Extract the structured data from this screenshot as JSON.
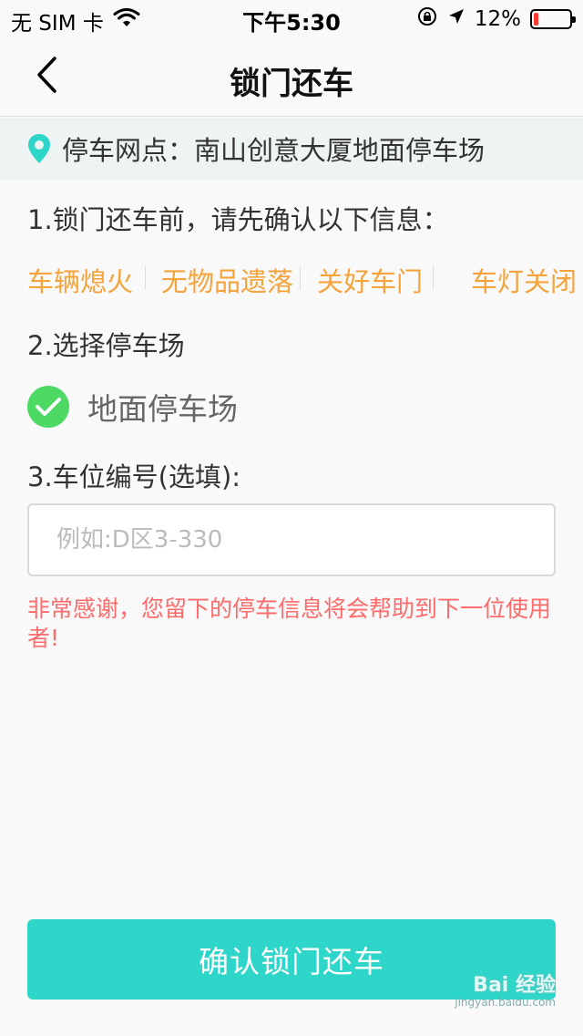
{
  "status_bar": {
    "carrier": "无 SIM 卡",
    "time": "下午5:30",
    "battery_percent": "12%",
    "battery_level": 0.12,
    "icons": [
      "wifi-icon",
      "orientation-lock-icon",
      "location-arrow-icon",
      "battery-icon"
    ],
    "battery_color": "#ff3b30"
  },
  "nav": {
    "title": "锁门还车",
    "back_icon": "chevron-left-icon"
  },
  "location": {
    "label": "停车网点：南山创意大厦地面停车场",
    "icon": "location-pin-icon",
    "icon_color": "#2ed5c9"
  },
  "section1": {
    "title": "1.锁门还车前，请先确认以下信息：",
    "items": [
      "车辆熄火",
      "无物品遗落",
      "关好车门",
      "车灯关闭"
    ],
    "item_color": "#f5a33b"
  },
  "section2": {
    "title": "2.选择停车场",
    "option_label": "地面停车场",
    "selected": true,
    "check_color": "#4cd964"
  },
  "section3": {
    "title": "3.车位编号(选填):",
    "input_value": "",
    "input_placeholder": "例如:D区3-330"
  },
  "note": {
    "text": "非常感谢，您留下的停车信息将会帮助到下一位使用者!",
    "color": "#ff6b6b"
  },
  "confirm_button": {
    "label": "确认锁门还车",
    "color": "#2ed5c9"
  },
  "watermark": {
    "main": "Bai 经验",
    "sub": "jingyan.baidu.com"
  }
}
